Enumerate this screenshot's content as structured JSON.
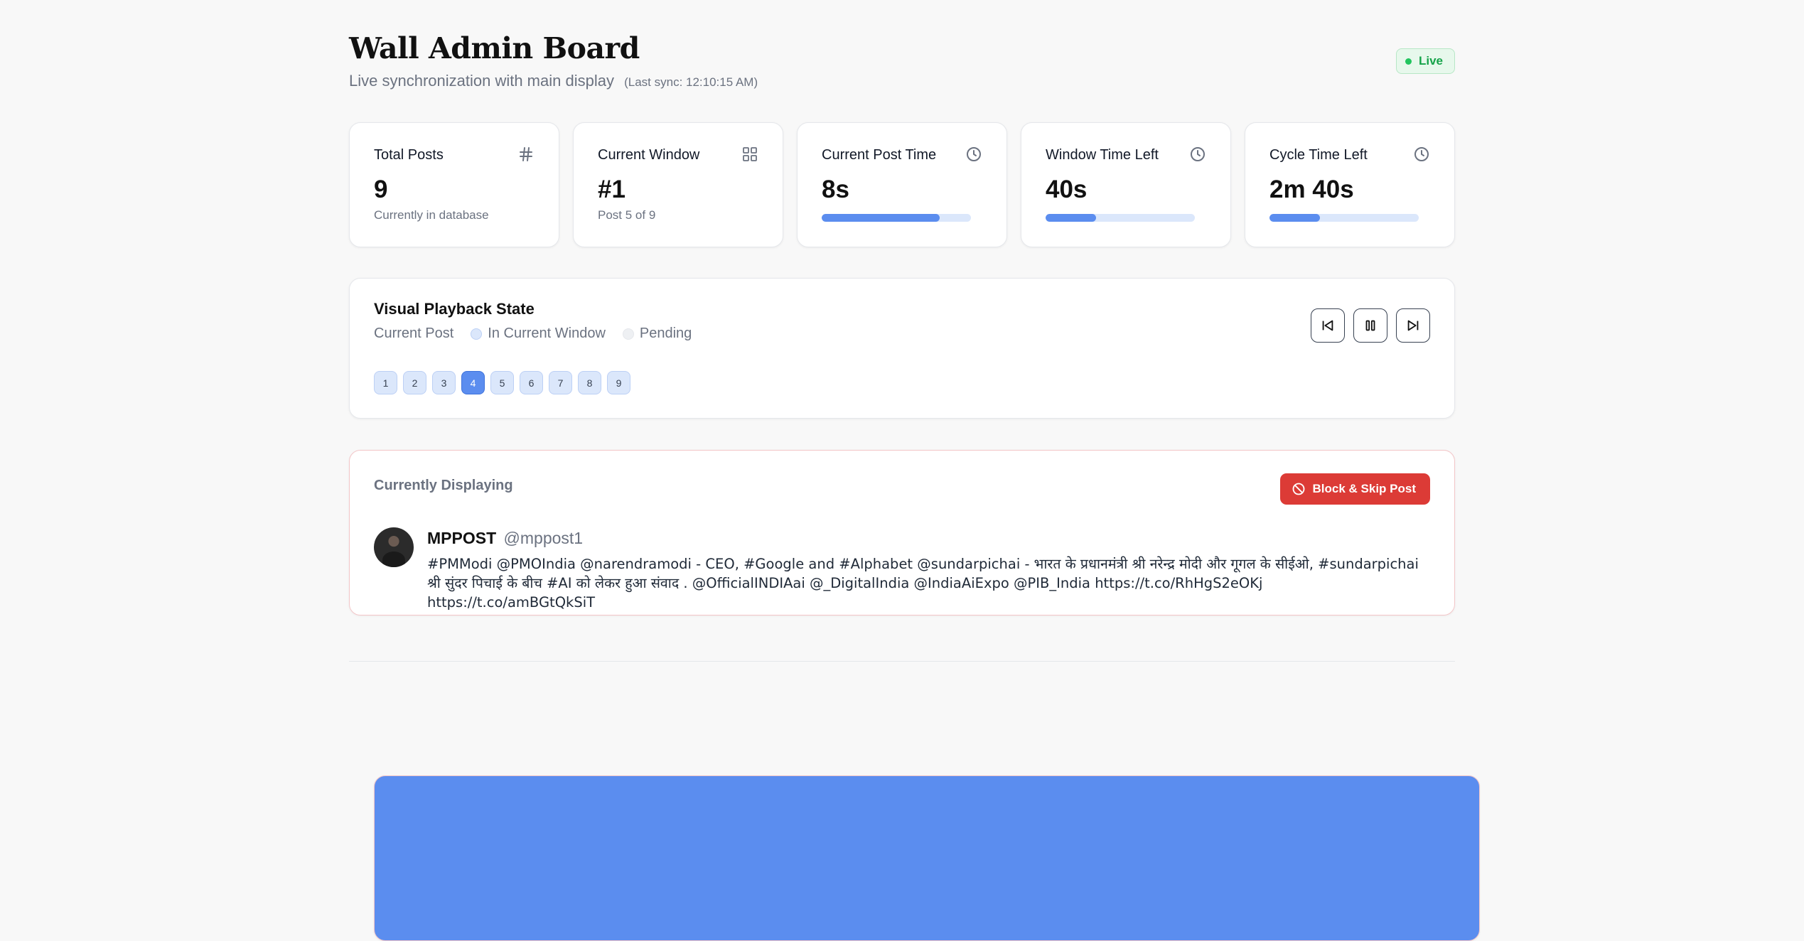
{
  "header": {
    "title": "Wall Admin Board",
    "subtitle": "Live synchronization with main display",
    "last_sync": "(Last sync: 12:10:15 AM)",
    "live_label": "Live"
  },
  "stats": [
    {
      "label": "Total Posts",
      "value": "9",
      "sub": "Currently in database",
      "icon": "hash-icon"
    },
    {
      "label": "Current Window",
      "value": "#1",
      "sub": "Post 5 of 9",
      "icon": "grid-icon"
    },
    {
      "label": "Current Post Time",
      "value": "8s",
      "progress": 0.79,
      "icon": "clock-icon"
    },
    {
      "label": "Window Time Left",
      "value": "40s",
      "progress": 0.34,
      "icon": "clock-icon"
    },
    {
      "label": "Cycle Time Left",
      "value": "2m 40s",
      "progress": 0.34,
      "icon": "clock-icon"
    }
  ],
  "playback": {
    "title": "Visual Playback State",
    "legend": [
      "Current Post",
      "In Current Window",
      "Pending"
    ],
    "posts": [
      "1",
      "2",
      "3",
      "4",
      "5",
      "6",
      "7",
      "8",
      "9"
    ],
    "active_post": "4",
    "controls": [
      "skip-back-icon",
      "pause-icon",
      "skip-forward-icon"
    ]
  },
  "current": {
    "label": "Currently Displaying",
    "block_label": "Block & Skip Post",
    "author_name": "MPPOST",
    "author_handle": "@mppost1",
    "text": "#PMModi @PMOIndia @narendramodi - CEO, #Google and #Alphabet @sundarpichai - भारत के प्रधानमंत्री श्री नरेन्द्र मोदी और गूगल के सीईओ, #sundarpichai श्री सुंदर पिचाई के बीच #AI को लेकर हुआ संवाद . @OfficialINDIAai @_DigitalIndia @IndiaAiExpo @PIB_India https://t.co/RhHgS2eOKj https://t.co/amBGtQkSiT"
  },
  "colors": {
    "accent": "#5b8def",
    "live_green": "#16a34a",
    "danger": "#dc3b36"
  }
}
